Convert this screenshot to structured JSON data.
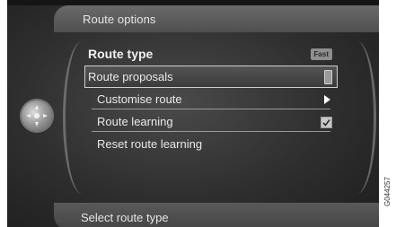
{
  "header": {
    "title": "Route options"
  },
  "menu": {
    "items": [
      {
        "label": "Route type",
        "value_badge": "Fast"
      },
      {
        "label": "Route proposals"
      },
      {
        "label": "Customise route"
      },
      {
        "label": "Route learning",
        "checked": true
      },
      {
        "label": "Reset route learning"
      }
    ]
  },
  "footer": {
    "status": "Select route type"
  },
  "figure_id": "G044257",
  "icons": {
    "knob": "rotary-knob-icon",
    "submenu_arrow": "chevron-right-icon",
    "checkbox": "checkmark-icon"
  }
}
